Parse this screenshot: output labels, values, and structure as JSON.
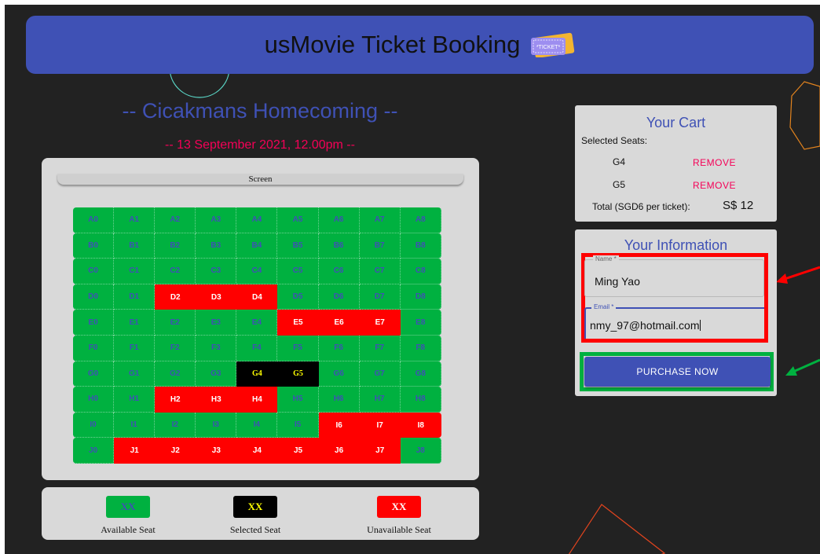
{
  "app": {
    "title": "usMovie Ticket Booking",
    "ticket_icon_text": "*TICKET*"
  },
  "movie": {
    "title": "-- Cicakmans Homecoming --",
    "date": "-- 13 September 2021, 12.00pm --"
  },
  "screen_label": "Screen",
  "seat_rows": [
    {
      "row": "A",
      "seats": [
        [
          "A0",
          "available"
        ],
        [
          "A1",
          "available"
        ],
        [
          "A2",
          "available"
        ],
        [
          "A3",
          "available"
        ],
        [
          "A4",
          "available"
        ],
        [
          "A5",
          "available"
        ],
        [
          "A6",
          "available"
        ],
        [
          "A7",
          "available"
        ],
        [
          "A8",
          "available"
        ]
      ]
    },
    {
      "row": "B",
      "seats": [
        [
          "B0",
          "available"
        ],
        [
          "B1",
          "available"
        ],
        [
          "B2",
          "available"
        ],
        [
          "B3",
          "available"
        ],
        [
          "B4",
          "available"
        ],
        [
          "B5",
          "available"
        ],
        [
          "B6",
          "available"
        ],
        [
          "B7",
          "available"
        ],
        [
          "B8",
          "available"
        ]
      ]
    },
    {
      "row": "C",
      "seats": [
        [
          "C0",
          "available"
        ],
        [
          "C1",
          "available"
        ],
        [
          "C2",
          "available"
        ],
        [
          "C3",
          "available"
        ],
        [
          "C4",
          "available"
        ],
        [
          "C5",
          "available"
        ],
        [
          "C6",
          "available"
        ],
        [
          "C7",
          "available"
        ],
        [
          "C8",
          "available"
        ]
      ]
    },
    {
      "row": "D",
      "seats": [
        [
          "D0",
          "available"
        ],
        [
          "D1",
          "available"
        ],
        [
          "D2",
          "unavailable"
        ],
        [
          "D3",
          "unavailable"
        ],
        [
          "D4",
          "unavailable"
        ],
        [
          "D5",
          "available"
        ],
        [
          "D6",
          "available"
        ],
        [
          "D7",
          "available"
        ],
        [
          "D8",
          "available"
        ]
      ]
    },
    {
      "row": "E",
      "seats": [
        [
          "E0",
          "available"
        ],
        [
          "E1",
          "available"
        ],
        [
          "E2",
          "available"
        ],
        [
          "E3",
          "available"
        ],
        [
          "E4",
          "available"
        ],
        [
          "E5",
          "unavailable"
        ],
        [
          "E6",
          "unavailable"
        ],
        [
          "E7",
          "unavailable"
        ],
        [
          "E8",
          "available"
        ]
      ]
    },
    {
      "row": "F",
      "seats": [
        [
          "F0",
          "available"
        ],
        [
          "F1",
          "available"
        ],
        [
          "F2",
          "available"
        ],
        [
          "F3",
          "available"
        ],
        [
          "F4",
          "available"
        ],
        [
          "F5",
          "available"
        ],
        [
          "F6",
          "available"
        ],
        [
          "F7",
          "available"
        ],
        [
          "F8",
          "available"
        ]
      ]
    },
    {
      "row": "G",
      "seats": [
        [
          "G0",
          "available"
        ],
        [
          "G1",
          "available"
        ],
        [
          "G2",
          "available"
        ],
        [
          "G3",
          "available"
        ],
        [
          "G4",
          "selected"
        ],
        [
          "G5",
          "selected"
        ],
        [
          "G6",
          "available"
        ],
        [
          "G7",
          "available"
        ],
        [
          "G8",
          "available"
        ]
      ]
    },
    {
      "row": "H",
      "seats": [
        [
          "H0",
          "available"
        ],
        [
          "H1",
          "available"
        ],
        [
          "H2",
          "unavailable"
        ],
        [
          "H3",
          "unavailable"
        ],
        [
          "H4",
          "unavailable"
        ],
        [
          "H5",
          "available"
        ],
        [
          "H6",
          "available"
        ],
        [
          "H7",
          "available"
        ],
        [
          "H8",
          "available"
        ]
      ]
    },
    {
      "row": "I",
      "seats": [
        [
          "I0",
          "available"
        ],
        [
          "I1",
          "available"
        ],
        [
          "I2",
          "available"
        ],
        [
          "I3",
          "available"
        ],
        [
          "I4",
          "available"
        ],
        [
          "I5",
          "available"
        ],
        [
          "I6",
          "unavailable"
        ],
        [
          "I7",
          "unavailable"
        ],
        [
          "I8",
          "unavailable"
        ]
      ]
    },
    {
      "row": "J",
      "seats": [
        [
          "J0",
          "available"
        ],
        [
          "J1",
          "unavailable"
        ],
        [
          "J2",
          "unavailable"
        ],
        [
          "J3",
          "unavailable"
        ],
        [
          "J4",
          "unavailable"
        ],
        [
          "J5",
          "unavailable"
        ],
        [
          "J6",
          "unavailable"
        ],
        [
          "J7",
          "unavailable"
        ],
        [
          "J8",
          "available"
        ]
      ]
    }
  ],
  "legend": {
    "available": {
      "swatch": "XX",
      "label": "Available Seat"
    },
    "selected": {
      "swatch": "XX",
      "label": "Selected Seat"
    },
    "unavailable": {
      "swatch": "XX",
      "label": "Unavailable Seat"
    }
  },
  "cart": {
    "title": "Your Cart",
    "selected_label": "Selected Seats:",
    "items": [
      {
        "seat": "G4",
        "action": "REMOVE"
      },
      {
        "seat": "G5",
        "action": "REMOVE"
      }
    ],
    "total_label": "Total (SGD6 per ticket):",
    "total_value": "S$ 12"
  },
  "info": {
    "title": "Your Information",
    "name_label": "Name *",
    "name_value": "Ming Yao",
    "email_label": "Email *",
    "email_value": "nmy_97@hotmail.com",
    "purchase_label": "PURCHASE NOW"
  },
  "colors": {
    "primary": "#3f51b5",
    "accent": "#f50057",
    "available": "#00b140",
    "unavailable": "#ff0000",
    "selected": "#000000",
    "background": "#222222"
  }
}
